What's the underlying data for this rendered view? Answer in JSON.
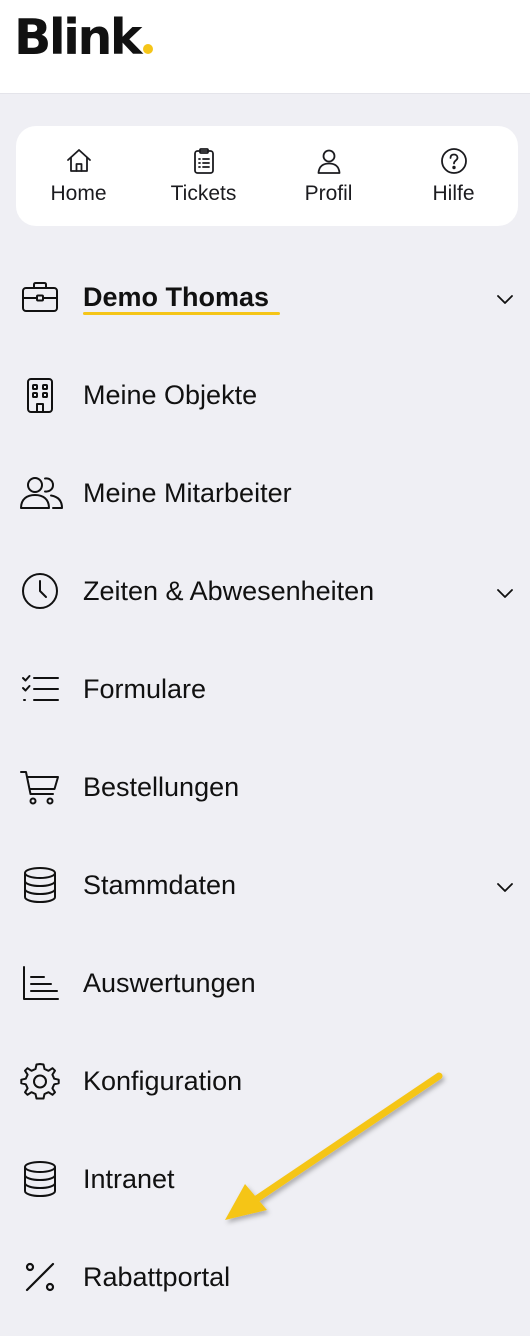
{
  "brand": {
    "logo_text": "Blink",
    "accent_color": "#f5c518"
  },
  "quicknav": [
    {
      "label": "Home",
      "icon": "home-icon"
    },
    {
      "label": "Tickets",
      "icon": "clipboard-icon"
    },
    {
      "label": "Profil",
      "icon": "user-icon"
    },
    {
      "label": "Hilfe",
      "icon": "help-circle-icon"
    }
  ],
  "menu": {
    "items": [
      {
        "label": "Demo Thomas",
        "icon": "briefcase-icon",
        "expandable": true,
        "active": true
      },
      {
        "label": "Meine Objekte",
        "icon": "building-icon",
        "expandable": false
      },
      {
        "label": "Meine Mitarbeiter",
        "icon": "users-icon",
        "expandable": false
      },
      {
        "label": "Zeiten & Abwesenheiten",
        "icon": "clock-icon",
        "expandable": true
      },
      {
        "label": "Formulare",
        "icon": "checklist-icon",
        "expandable": false
      },
      {
        "label": "Bestellungen",
        "icon": "cart-icon",
        "expandable": false
      },
      {
        "label": "Stammdaten",
        "icon": "database-icon",
        "expandable": true
      },
      {
        "label": "Auswertungen",
        "icon": "chart-icon",
        "expandable": false
      },
      {
        "label": "Konfiguration",
        "icon": "gear-icon",
        "expandable": false
      },
      {
        "label": "Intranet",
        "icon": "database-icon",
        "expandable": false
      },
      {
        "label": "Rabattportal",
        "icon": "percent-icon",
        "expandable": false
      }
    ]
  },
  "annotation": {
    "arrow_color": "#f5c518",
    "target": "Intranet"
  }
}
